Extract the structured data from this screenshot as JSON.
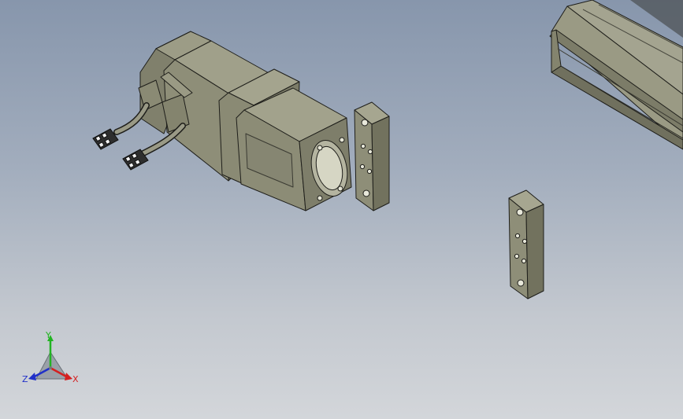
{
  "viewport": {
    "background_top": "#8796ac",
    "background_bottom": "#d3d6da",
    "part_color": "#8e8e78",
    "edge_color": "#1e1e1a"
  },
  "triad": {
    "x_label": "X",
    "y_label": "Y",
    "z_label": "Z",
    "x_color": "#d42020",
    "y_color": "#22b422",
    "z_color": "#2030c8"
  }
}
